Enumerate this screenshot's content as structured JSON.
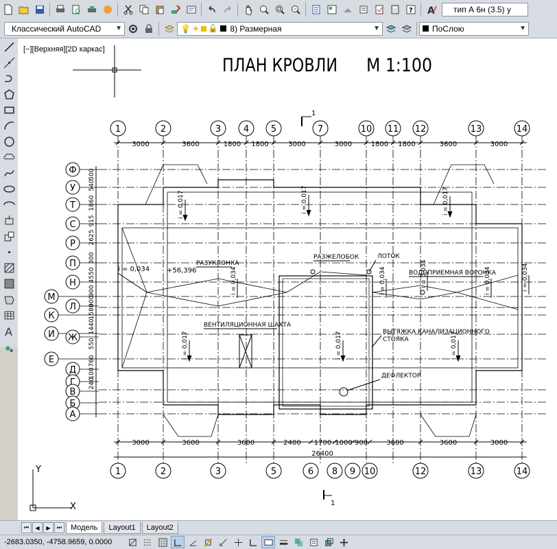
{
  "toolbar_top": {
    "text_style_value": "тип А 6н (3.5) у"
  },
  "toolbar_second": {
    "workspace": "Классический AutoCAD",
    "layer": "8) Размерная",
    "color": "ПоСлою"
  },
  "viewport": {
    "label": "[−][Верхняя][2D каркас]"
  },
  "drawing": {
    "title": "ПЛАН КРОВЛИ",
    "scale": "М 1:100",
    "top_axes": [
      "1",
      "2",
      "3",
      "4",
      "5",
      "7",
      "10",
      "11",
      "12",
      "13",
      "14"
    ],
    "top_dims": [
      "3000",
      "3600",
      "1800",
      "1800",
      "3000",
      "3000",
      "1800",
      "1800",
      "3600",
      "3000"
    ],
    "bottom_axes": [
      "1",
      "2",
      "3",
      "5",
      "6",
      "8",
      "9",
      "10",
      "12",
      "13",
      "14"
    ],
    "bottom_dims": [
      "3000",
      "3600",
      "3600",
      "2400",
      "1700",
      "1000",
      "900",
      "3600",
      "3600",
      "3000"
    ],
    "bottom_total": "26400",
    "left_axes": [
      "Ф",
      "У",
      "Т",
      "С",
      "Р",
      "П",
      "Н",
      "М",
      "Л",
      "К",
      "И",
      "Ж",
      "Е",
      "Д",
      "Г",
      "В",
      "Б",
      "А"
    ],
    "left_dims": [
      "500",
      "540",
      "1860",
      "915",
      "2625",
      "300",
      "4550",
      "900",
      "900",
      "1580",
      "1440",
      "550",
      "760",
      "100",
      "240"
    ],
    "annotations": {
      "slope_1": "i = 0,034",
      "elev": "+56,396",
      "razuklonka": "РАЗУКЛОНКА",
      "razhelobok": "РАЗЖЕЛОБОК",
      "lotok": "ЛОТОК",
      "vodopriemnaya": "ВОДОПРИЕМНАЯ ВОРОНКА",
      "vent_shaft": "ВЕНТИЛЯЦИОННАЯ ШАХТА",
      "vytyazhka_1": "ВЫТЯЖКА КАНАЛИЗАЦИОННОГО",
      "vytyazhka_2": "СТОЯКА",
      "deflektor": "ДЕФЛЕКТОР",
      "slope_017": "i = 0,017",
      "slope_034": "i = 0,034",
      "section": "1"
    },
    "ucs_x": "X",
    "ucs_y": "Y"
  },
  "tabs": {
    "model": "Модель",
    "layout1": "Layout1",
    "layout2": "Layout2"
  },
  "status": {
    "coords": "-2683.0350, -4758.9659, 0.0000"
  }
}
